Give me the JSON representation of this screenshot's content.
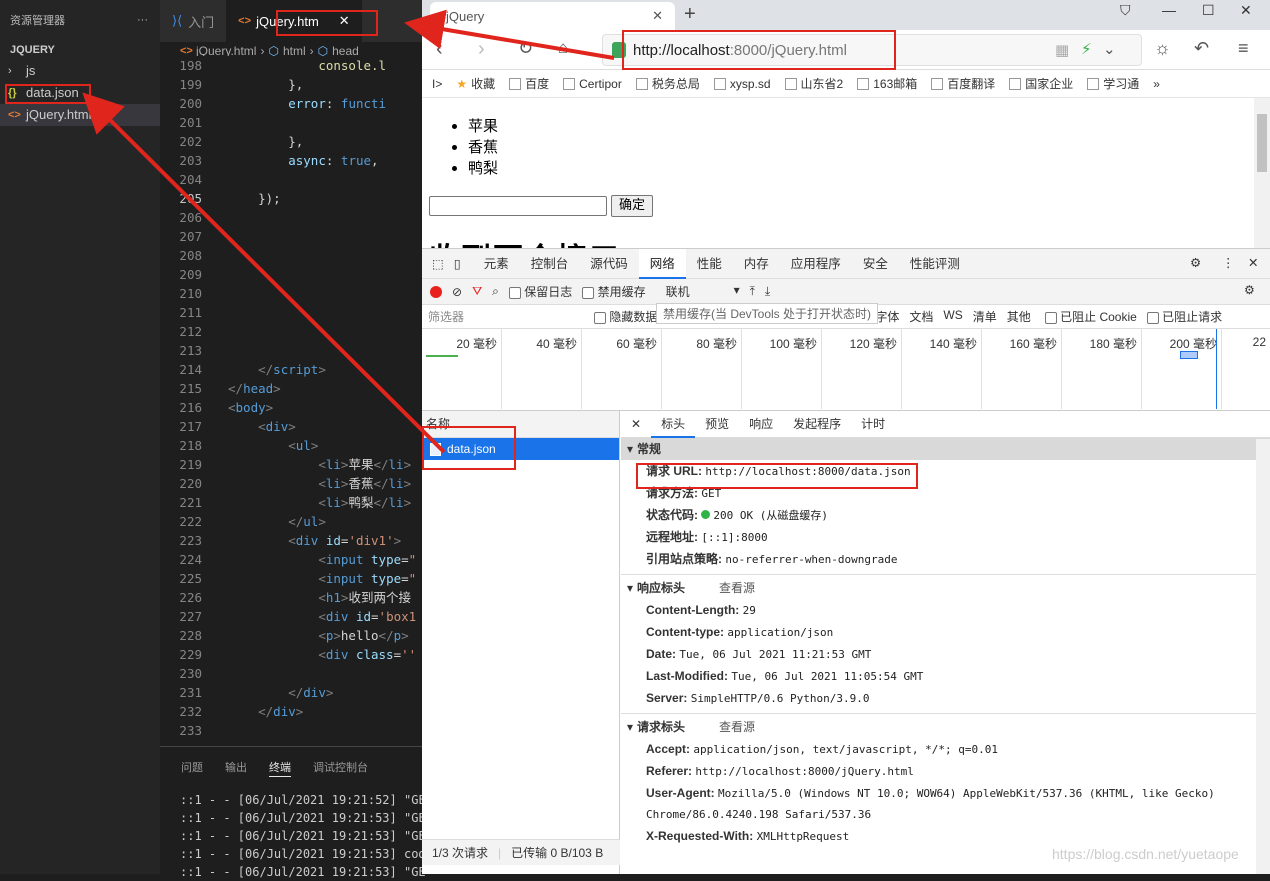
{
  "vscode": {
    "explorer_title": "资源管理器",
    "more": "···",
    "root": "JQUERY",
    "tree": [
      {
        "label": "js",
        "kind": "folder"
      },
      {
        "label": "data.json",
        "kind": "json"
      },
      {
        "label": "jQuery.html",
        "kind": "html",
        "selected": true
      }
    ],
    "tabs": [
      {
        "label": "入门",
        "active": false
      },
      {
        "label": "jQuery.htm",
        "active": true
      }
    ],
    "tab_close": "✕",
    "breadcrumb": [
      "jQuery.html",
      "html",
      "head"
    ],
    "lines": [
      {
        "n": "198",
        "html": "            <span class='fn'>console.l</span>"
      },
      {
        "n": "199",
        "html": "        },"
      },
      {
        "n": "200",
        "html": "        <span class='attr'>error</span>: <span class='kw'>functi</span>"
      },
      {
        "n": "201",
        "html": ""
      },
      {
        "n": "202",
        "html": "        },"
      },
      {
        "n": "203",
        "html": "        <span class='attr'>async</span>: <span class='kw'>true</span>,"
      },
      {
        "n": "204",
        "html": ""
      },
      {
        "n": "205",
        "html": "    });"
      },
      {
        "n": "206",
        "html": ""
      },
      {
        "n": "207",
        "html": ""
      },
      {
        "n": "208",
        "html": ""
      },
      {
        "n": "209",
        "html": ""
      },
      {
        "n": "210",
        "html": ""
      },
      {
        "n": "211",
        "html": ""
      },
      {
        "n": "212",
        "html": ""
      },
      {
        "n": "213",
        "html": ""
      },
      {
        "n": "214",
        "html": "    <span class='punc'>&lt;/</span><span class='tag'>script</span><span class='punc'>&gt;</span>"
      },
      {
        "n": "215",
        "html": "<span class='punc'>&lt;/</span><span class='tag'>head</span><span class='punc'>&gt;</span>"
      },
      {
        "n": "216",
        "html": "<span class='punc'>&lt;</span><span class='tag'>body</span><span class='punc'>&gt;</span>"
      },
      {
        "n": "217",
        "html": "    <span class='punc'>&lt;</span><span class='tag'>div</span><span class='punc'>&gt;</span>"
      },
      {
        "n": "218",
        "html": "        <span class='punc'>&lt;</span><span class='tag'>ul</span><span class='punc'>&gt;</span>"
      },
      {
        "n": "219",
        "html": "            <span class='punc'>&lt;</span><span class='tag'>li</span><span class='punc'>&gt;</span>苹果<span class='punc'>&lt;/</span><span class='tag'>li</span><span class='punc'>&gt;</span>"
      },
      {
        "n": "220",
        "html": "            <span class='punc'>&lt;</span><span class='tag'>li</span><span class='punc'>&gt;</span>香蕉<span class='punc'>&lt;/</span><span class='tag'>li</span><span class='punc'>&gt;</span>"
      },
      {
        "n": "221",
        "html": "            <span class='punc'>&lt;</span><span class='tag'>li</span><span class='punc'>&gt;</span>鸭梨<span class='punc'>&lt;/</span><span class='tag'>li</span><span class='punc'>&gt;</span>"
      },
      {
        "n": "222",
        "html": "        <span class='punc'>&lt;/</span><span class='tag'>ul</span><span class='punc'>&gt;</span>"
      },
      {
        "n": "223",
        "html": "        <span class='punc'>&lt;</span><span class='tag'>div</span> <span class='attr'>id</span>=<span class='str'>'div1'</span><span class='punc'>&gt;</span>"
      },
      {
        "n": "224",
        "html": "            <span class='punc'>&lt;</span><span class='tag'>input</span> <span class='attr'>type</span>=<span class='str'>\"</span>"
      },
      {
        "n": "225",
        "html": "            <span class='punc'>&lt;</span><span class='tag'>input</span> <span class='attr'>type</span>=<span class='str'>\"</span>"
      },
      {
        "n": "226",
        "html": "            <span class='punc'>&lt;</span><span class='tag'>h1</span><span class='punc'>&gt;</span>收到两个接"
      },
      {
        "n": "227",
        "html": "            <span class='punc'>&lt;</span><span class='tag'>div</span> <span class='attr'>id</span>=<span class='str'>'box1</span>"
      },
      {
        "n": "228",
        "html": "            <span class='punc'>&lt;</span><span class='tag'>p</span><span class='punc'>&gt;</span>hello<span class='punc'>&lt;/</span><span class='tag'>p</span><span class='punc'>&gt;</span>"
      },
      {
        "n": "229",
        "html": "            <span class='punc'>&lt;</span><span class='tag'>div</span> <span class='attr'>class</span>=<span class='str'>''</span>"
      },
      {
        "n": "230",
        "html": ""
      },
      {
        "n": "231",
        "html": "        <span class='punc'>&lt;/</span><span class='tag'>div</span><span class='punc'>&gt;</span>"
      },
      {
        "n": "232",
        "html": "    <span class='punc'>&lt;/</span><span class='tag'>div</span><span class='punc'>&gt;</span>"
      },
      {
        "n": "233",
        "html": ""
      },
      {
        "n": "234",
        "html": ""
      }
    ],
    "panel_tabs": [
      "问题",
      "输出",
      "终端",
      "调试控制台"
    ],
    "terminal": [
      "::1 - - [06/Jul/2021 19:21:52] \"GE",
      "::1 - - [06/Jul/2021 19:21:53] \"GE",
      "::1 - - [06/Jul/2021 19:21:53] \"GE",
      "::1 - - [06/Jul/2021 19:21:53] code",
      "::1 - - [06/Jul/2021 19:21:53] \"GE"
    ]
  },
  "browser": {
    "tab_title": "jQuery",
    "url_host": "http://localhost",
    "url_rest": ":8000/jQuery.html",
    "bookmarks": [
      "收藏",
      "百度",
      "Certipor",
      "税务总局",
      "xysp.sd",
      "山东省2",
      "163邮箱",
      "百度翻译",
      "国家企业",
      "学习通"
    ],
    "page": {
      "items": [
        "苹果",
        "香蕉",
        "鸭梨"
      ],
      "button": "确定",
      "heading": "收到两个接口"
    }
  },
  "devtools": {
    "tabs": [
      "元素",
      "控制台",
      "源代码",
      "网络",
      "性能",
      "内存",
      "应用程序",
      "安全",
      "性能评测"
    ],
    "active_tab": "网络",
    "row2": {
      "preserve_log": "保留日志",
      "disable_cache": "禁用缓存",
      "throttle": "联机"
    },
    "tooltip": "禁用缓存(当 DevTools 处于打开状态时)",
    "filter_placeholder": "筛选器",
    "hide_data": "隐藏数据",
    "types": [
      "字体",
      "文档",
      "WS",
      "清单",
      "其他"
    ],
    "blocked_cookies": "已阻止 Cookie",
    "blocked_requests": "已阻止请求",
    "timeline_ticks": [
      "20 毫秒",
      "40 毫秒",
      "60 毫秒",
      "80 毫秒",
      "100 毫秒",
      "120 毫秒",
      "140 毫秒",
      "160 毫秒",
      "180 毫秒",
      "200 毫秒",
      "22"
    ],
    "name_header": "名称",
    "request_name": "data.json",
    "footer_requests": "1/3 次请求",
    "footer_transferred": "已传输 0 B/103 B",
    "detail_tabs": [
      "标头",
      "预览",
      "响应",
      "发起程序",
      "计时"
    ],
    "general_title": "常规",
    "general": [
      {
        "k": "请求 URL:",
        "v": "http://localhost:8000/data.json"
      },
      {
        "k": "请求方法:",
        "v": "GET"
      },
      {
        "k": "状态代码:",
        "v": "200 OK (从磁盘缓存)"
      },
      {
        "k": "远程地址:",
        "v": "[::1]:8000"
      },
      {
        "k": "引用站点策略:",
        "v": "no-referrer-when-downgrade"
      }
    ],
    "resp_title": "响应标头",
    "view_source": "查看源",
    "response_headers": [
      {
        "k": "Content-Length:",
        "v": "29"
      },
      {
        "k": "Content-type:",
        "v": "application/json"
      },
      {
        "k": "Date:",
        "v": "Tue, 06 Jul 2021 11:21:53 GMT"
      },
      {
        "k": "Last-Modified:",
        "v": "Tue, 06 Jul 2021 11:05:54 GMT"
      },
      {
        "k": "Server:",
        "v": "SimpleHTTP/0.6 Python/3.9.0"
      }
    ],
    "req_title": "请求标头",
    "request_headers": [
      {
        "k": "Accept:",
        "v": "application/json, text/javascript, */*; q=0.01"
      },
      {
        "k": "Referer:",
        "v": "http://localhost:8000/jQuery.html"
      },
      {
        "k": "User-Agent:",
        "v": "Mozilla/5.0 (Windows NT 10.0; WOW64) AppleWebKit/537.36 (KHTML, like Gecko) Chrome/86.0.4240.198 Safari/537.36"
      },
      {
        "k": "X-Requested-With:",
        "v": "XMLHttpRequest"
      }
    ]
  },
  "watermark": "https://blog.csdn.net/yuetaope",
  "colors": {
    "annotation": "#e0251d",
    "accent": "#1a73e8",
    "status_ok": "#2fb344"
  }
}
